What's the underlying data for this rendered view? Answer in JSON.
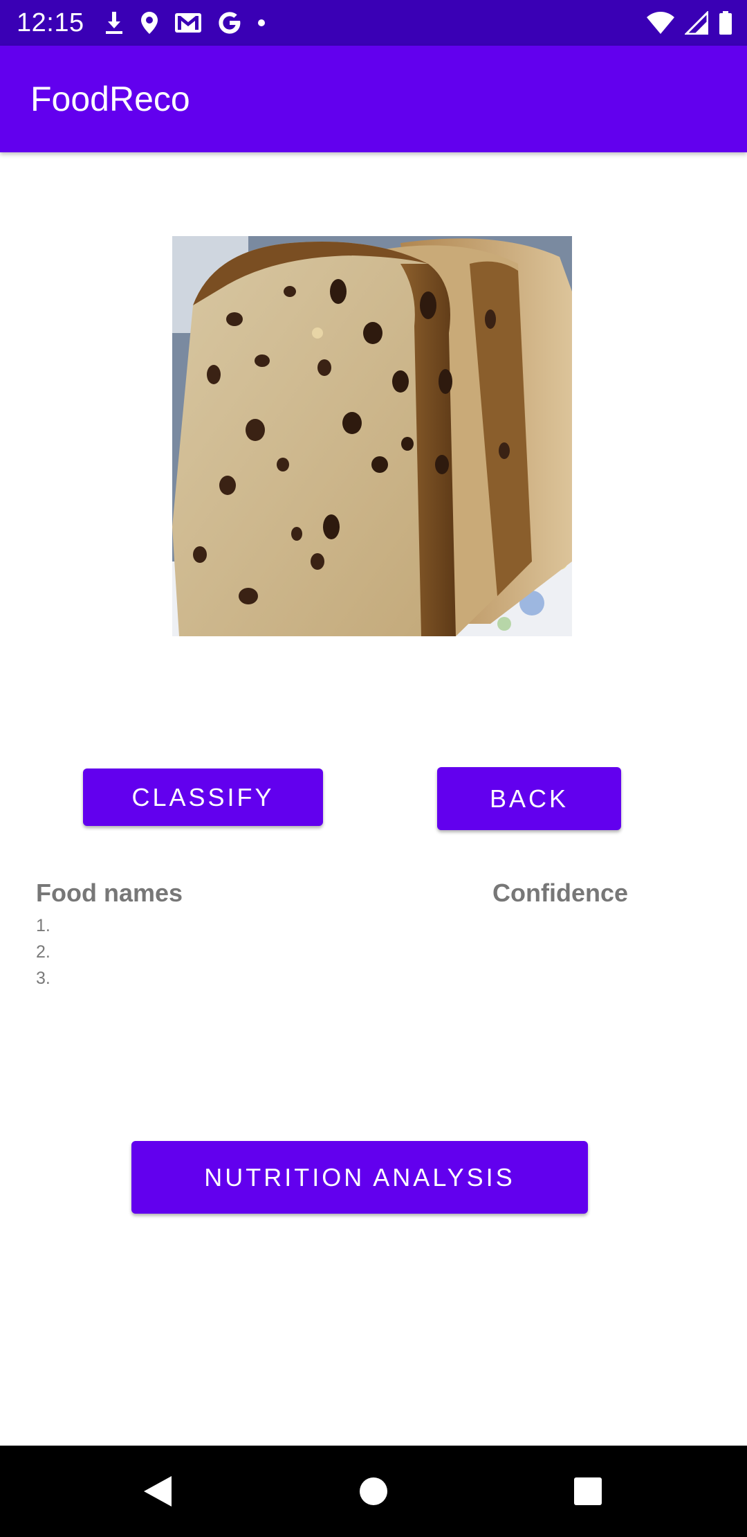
{
  "status_bar": {
    "time": "12:15",
    "left_icons": [
      "download-icon",
      "location-icon",
      "gmail-icon",
      "google-icon",
      "dot-icon"
    ],
    "right_icons": [
      "wifi-icon",
      "signal-icon",
      "battery-icon"
    ],
    "color": "#3a00b5"
  },
  "app_bar": {
    "title": "FoodReco",
    "color": "#6200ee"
  },
  "image": {
    "icon": "bread-photo"
  },
  "buttons": {
    "classify": "CLASSIFY",
    "back": "BACK",
    "nutrition": "NUTRITION ANALYSIS",
    "color": "#6200ee"
  },
  "results": {
    "food_header": "Food names",
    "confidence_header": "Confidence",
    "items": [
      "1.",
      "2.",
      "3."
    ]
  },
  "nav_bar": {
    "icons": [
      "back-icon",
      "home-icon",
      "recents-icon"
    ]
  }
}
